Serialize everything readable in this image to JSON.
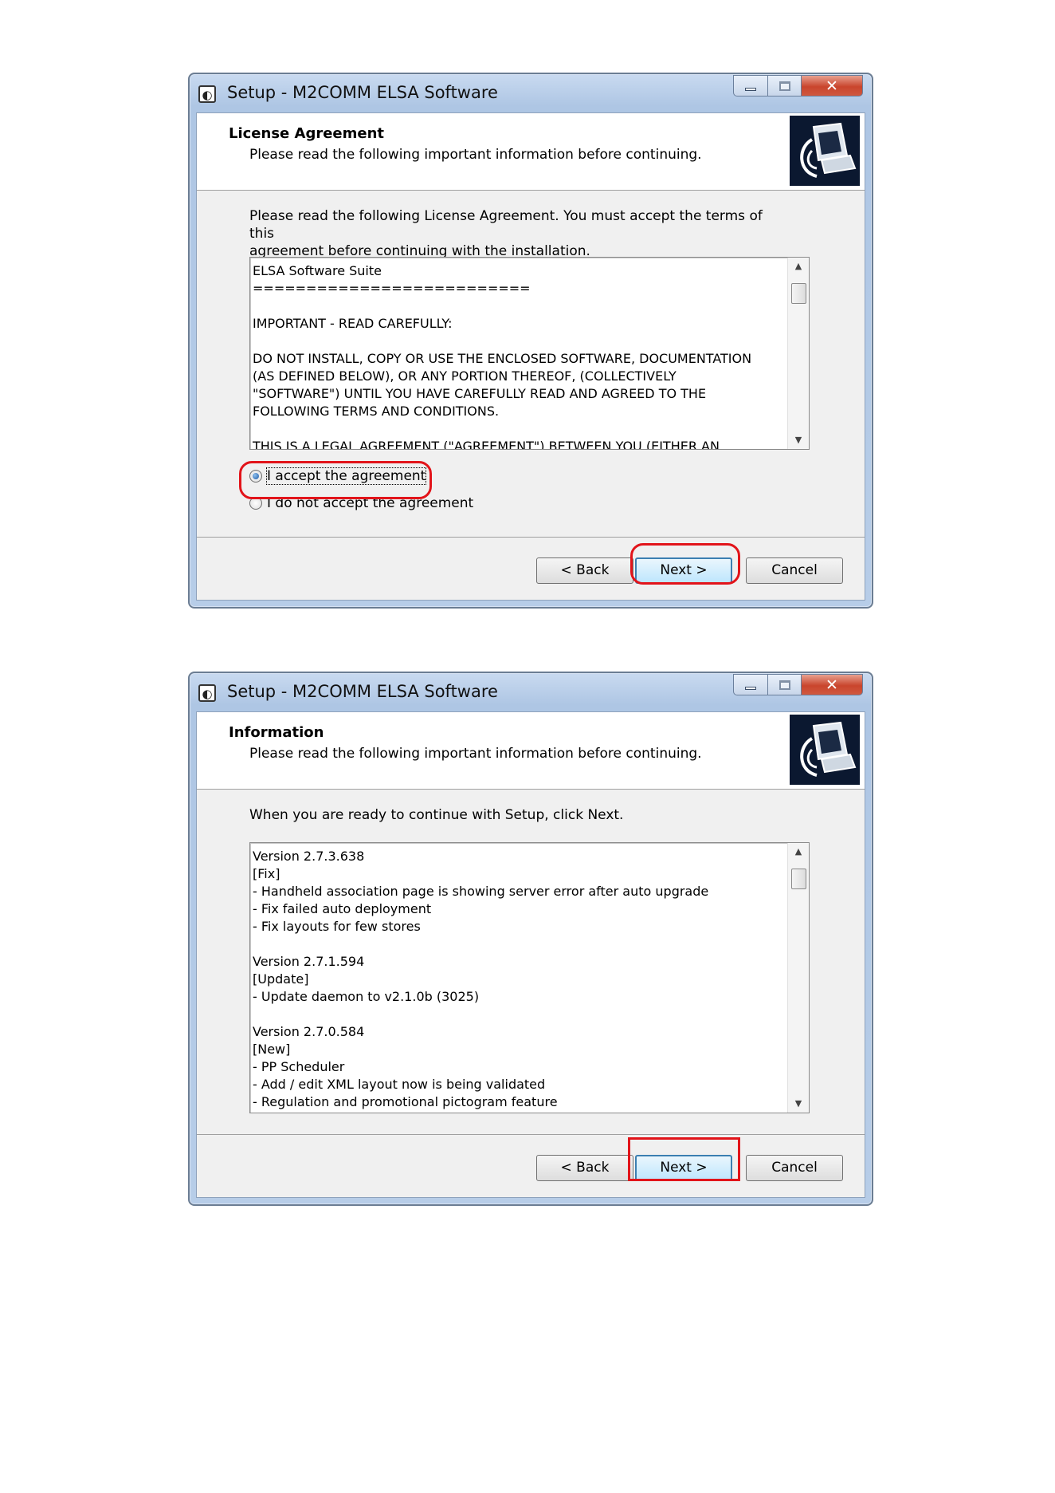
{
  "dialog1": {
    "window_title": "Setup - M2COMM ELSA Software",
    "header_title": "License Agreement",
    "header_subtitle": "Please read the following important information before continuing.",
    "instruction_line1": "Please read the following License Agreement. You must accept the terms of this",
    "instruction_line2": "agreement before continuing with the installation.",
    "license_lines": [
      "ELSA Software Suite",
      "==========================",
      "",
      "IMPORTANT - READ CAREFULLY:",
      "",
      "DO NOT INSTALL, COPY OR USE THE ENCLOSED SOFTWARE, DOCUMENTATION",
      "(AS DEFINED BELOW), OR ANY PORTION THEREOF, (COLLECTIVELY",
      "\"SOFTWARE\") UNTIL YOU HAVE CAREFULLY READ AND AGREED TO THE",
      "FOLLOWING TERMS AND CONDITIONS.",
      "",
      "THIS IS A LEGAL AGREEMENT (\"AGREEMENT\") BETWEEN YOU (EITHER AN"
    ],
    "radio_accept": "I accept the agreement",
    "radio_decline": "I do not accept the agreement",
    "accept_selected": true,
    "buttons": {
      "back": "< Back",
      "next": "Next >",
      "cancel": "Cancel"
    }
  },
  "dialog2": {
    "window_title": "Setup - M2COMM ELSA Software",
    "header_title": "Information",
    "header_subtitle": "Please read the following important information before continuing.",
    "instruction": "When you are ready to continue with Setup, click Next.",
    "info_lines": [
      "Version 2.7.3.638",
      "[Fix]",
      "- Handheld association page is showing server error after auto upgrade",
      "- Fix failed auto deployment",
      "- Fix layouts for few stores",
      "",
      "Version 2.7.1.594",
      "[Update]",
      "- Update daemon to v2.1.0b (3025)",
      "",
      "Version 2.7.0.584",
      "[New]",
      "- PP Scheduler",
      "- Add / edit XML layout now is being validated",
      "- Regulation and promotional pictogram feature"
    ],
    "buttons": {
      "back": "< Back",
      "next": "Next >",
      "cancel": "Cancel"
    }
  },
  "highlight_color": "#e2141a",
  "icons": [
    "setup-app-icon",
    "minimize-icon",
    "maximize-icon",
    "close-icon",
    "installer-computer-icon",
    "scroll-up-arrow-icon",
    "scroll-down-arrow-icon"
  ]
}
